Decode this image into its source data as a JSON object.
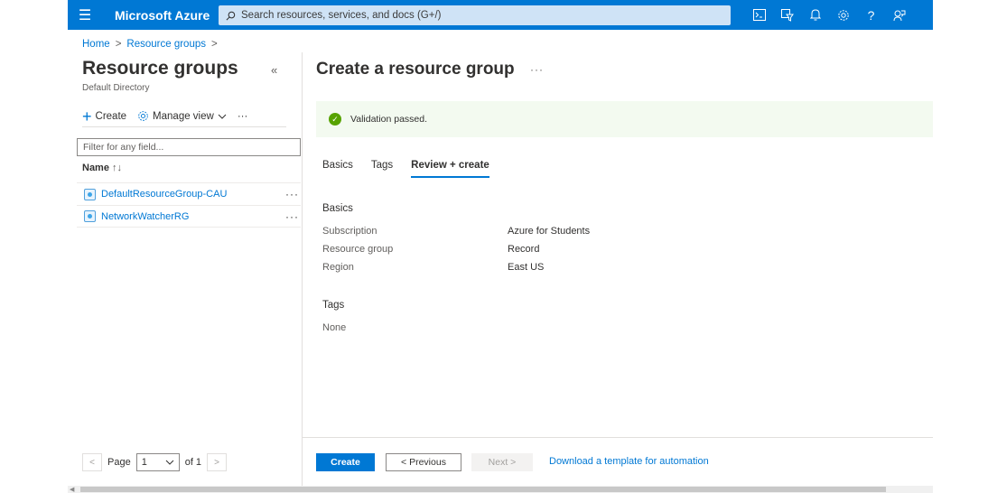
{
  "topbar": {
    "brand": "Microsoft Azure",
    "search_placeholder": "Search resources, services, and docs (G+/)",
    "accent": "#0078d4",
    "icons": [
      "cloud-shell-icon",
      "directory-filter-icon",
      "notifications-icon",
      "settings-icon",
      "help-icon",
      "feedback-icon"
    ]
  },
  "breadcrumb": {
    "home": "Home",
    "resource_groups": "Resource groups"
  },
  "left_pane": {
    "title": "Resource groups",
    "subtitle": "Default Directory",
    "toolbar": {
      "create": "Create",
      "manage_view": "Manage view",
      "more": "···"
    },
    "filter_placeholder": "Filter for any field...",
    "column_name": "Name",
    "items": [
      {
        "name": "DefaultResourceGroup-CAU"
      },
      {
        "name": "NetworkWatcherRG"
      }
    ],
    "pager": {
      "page_label": "Page",
      "page_value": "1",
      "of_label": "of 1"
    }
  },
  "right_pane": {
    "title": "Create a resource group",
    "validation": "Validation passed.",
    "tabs": [
      {
        "label": "Basics",
        "active": false
      },
      {
        "label": "Tags",
        "active": false
      },
      {
        "label": "Review + create",
        "active": true
      }
    ],
    "basics_heading": "Basics",
    "fields": [
      {
        "key": "Subscription",
        "value": "Azure for Students"
      },
      {
        "key": "Resource group",
        "value": "Record"
      },
      {
        "key": "Region",
        "value": "East US"
      }
    ],
    "tags_heading": "Tags",
    "tags_value": "None"
  },
  "footer": {
    "create": "Create",
    "previous": "< Previous",
    "next": "Next >",
    "download": "Download a template for automation"
  }
}
